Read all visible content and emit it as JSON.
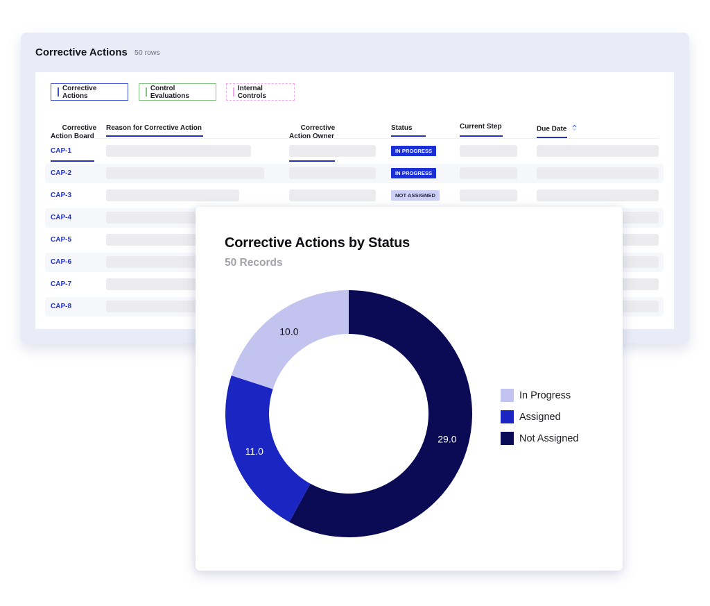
{
  "table_panel": {
    "title": "Corrective Actions",
    "row_count": "50 rows",
    "tabs": [
      {
        "label": "Corrective Actions",
        "color": "#3a50d6"
      },
      {
        "label": "Control Evaluations",
        "color": "#7cc07c"
      },
      {
        "label": "Internal Controls",
        "color": "#f3a6ef"
      }
    ],
    "columns": [
      {
        "label": "Corrective\nAction Board"
      },
      {
        "label": "Reason for Corrective Action"
      },
      {
        "label": "Corrective\nAction Owner"
      },
      {
        "label": "Status"
      },
      {
        "label": "Current Step"
      },
      {
        "label": "Due Date",
        "sort_icon": "sort-chevrons-icon"
      }
    ],
    "rows": [
      {
        "id": "CAP-1",
        "status": "IN PROGRESS"
      },
      {
        "id": "CAP-2",
        "status": "IN PROGRESS"
      },
      {
        "id": "CAP-3",
        "status": "NOT ASSIGNED"
      },
      {
        "id": "CAP-4",
        "status": ""
      },
      {
        "id": "CAP-5",
        "status": ""
      },
      {
        "id": "CAP-6",
        "status": ""
      },
      {
        "id": "CAP-7",
        "status": ""
      },
      {
        "id": "CAP-8",
        "status": ""
      }
    ],
    "accent_color": "#2234cf"
  },
  "chart_card": {
    "title": "Corrective Actions by Status",
    "subtitle": "50 Records"
  },
  "chart_data": {
    "type": "pie",
    "variant": "donut",
    "title": "Corrective Actions by Status",
    "subtitle": "50 Records",
    "categories": [
      "Not Assigned",
      "Assigned",
      "In Progress"
    ],
    "values": [
      29.0,
      11.0,
      10.0
    ],
    "data_labels": [
      "29.0",
      "11.0",
      "10.0"
    ],
    "colors": [
      "#0a0a55",
      "#1a25c2",
      "#c3c3ef"
    ],
    "label_colors": [
      "#ffffff",
      "#ffffff",
      "#111111"
    ],
    "legend": {
      "position": "right",
      "entries": [
        {
          "label": "In Progress",
          "color": "#c3c3ef"
        },
        {
          "label": "Assigned",
          "color": "#1a25c2"
        },
        {
          "label": "Not Assigned",
          "color": "#0a0a55"
        }
      ]
    },
    "start_angle": "top",
    "direction": "clockwise"
  }
}
